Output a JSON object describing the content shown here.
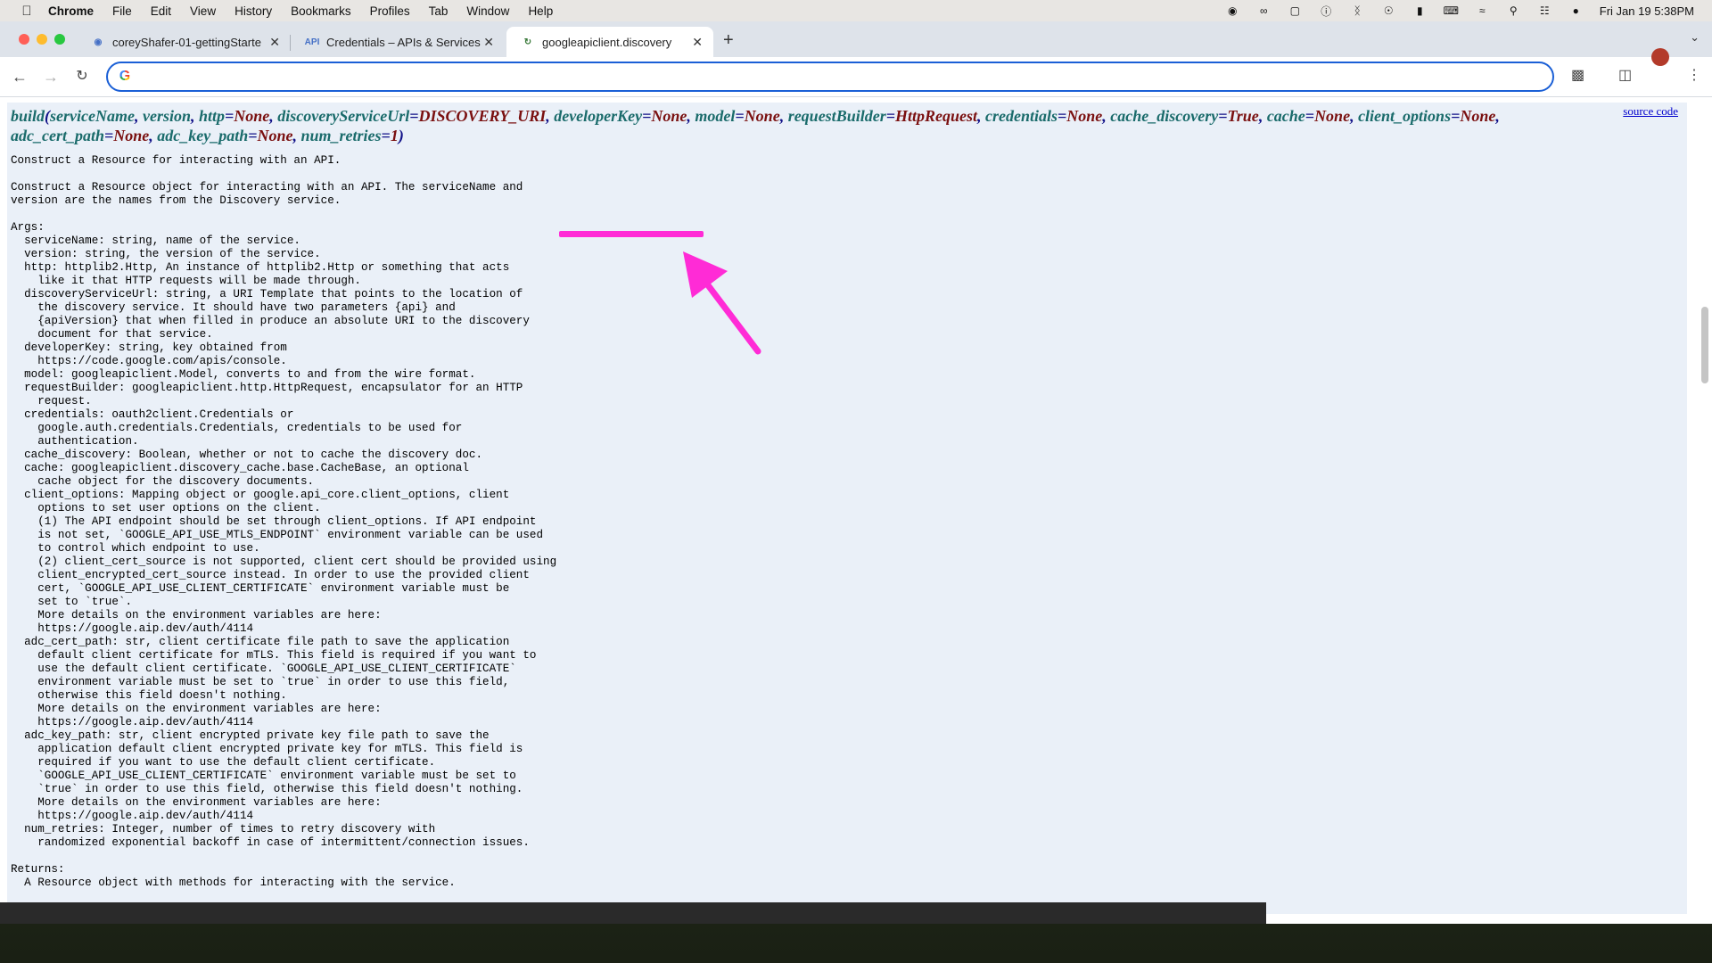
{
  "menubar": {
    "app": "Chrome",
    "items": [
      "File",
      "Edit",
      "View",
      "History",
      "Bookmarks",
      "Profiles",
      "Tab",
      "Window",
      "Help"
    ],
    "datetime": "Fri Jan 19  5:38PM"
  },
  "tabs": [
    {
      "title": "coreyShafer-01-gettingStarte",
      "favicon": "github-icon"
    },
    {
      "title": "Credentials – APIs & Services",
      "favicon": "api-icon",
      "favicon_text": "API"
    },
    {
      "title": "googleapiclient.discovery",
      "favicon": "loading-icon",
      "active": true
    }
  ],
  "omnibox": {
    "value": ""
  },
  "doc": {
    "source_link": "source code",
    "signature": {
      "name": "build",
      "params": [
        {
          "name": "serviceName"
        },
        {
          "name": "version"
        },
        {
          "name": "http",
          "default": "None"
        },
        {
          "name": "discoveryServiceUrl",
          "default": "DISCOVERY_URI"
        },
        {
          "name": "developerKey",
          "default": "None"
        },
        {
          "name": "model",
          "default": "None"
        },
        {
          "name": "requestBuilder",
          "default": "HttpRequest"
        },
        {
          "name": "credentials",
          "default": "None"
        },
        {
          "name": "cache_discovery",
          "default": "True"
        },
        {
          "name": "cache",
          "default": "None"
        },
        {
          "name": "client_options",
          "default": "None"
        },
        {
          "name": "adc_cert_path",
          "default": "None"
        },
        {
          "name": "adc_key_path",
          "default": "None"
        },
        {
          "name": "num_retries",
          "default": "1"
        }
      ]
    },
    "docstring": "Construct a Resource for interacting with an API.\n\nConstruct a Resource object for interacting with an API. The serviceName and\nversion are the names from the Discovery service.\n\nArgs:\n  serviceName: string, name of the service.\n  version: string, the version of the service.\n  http: httplib2.Http, An instance of httplib2.Http or something that acts\n    like it that HTTP requests will be made through.\n  discoveryServiceUrl: string, a URI Template that points to the location of\n    the discovery service. It should have two parameters {api} and\n    {apiVersion} that when filled in produce an absolute URI to the discovery\n    document for that service.\n  developerKey: string, key obtained from\n    https://code.google.com/apis/console.\n  model: googleapiclient.Model, converts to and from the wire format.\n  requestBuilder: googleapiclient.http.HttpRequest, encapsulator for an HTTP\n    request.\n  credentials: oauth2client.Credentials or\n    google.auth.credentials.Credentials, credentials to be used for\n    authentication.\n  cache_discovery: Boolean, whether or not to cache the discovery doc.\n  cache: googleapiclient.discovery_cache.base.CacheBase, an optional\n    cache object for the discovery documents.\n  client_options: Mapping object or google.api_core.client_options, client\n    options to set user options on the client.\n    (1) The API endpoint should be set through client_options. If API endpoint\n    is not set, `GOOGLE_API_USE_MTLS_ENDPOINT` environment variable can be used\n    to control which endpoint to use.\n    (2) client_cert_source is not supported, client cert should be provided using\n    client_encrypted_cert_source instead. In order to use the provided client\n    cert, `GOOGLE_API_USE_CLIENT_CERTIFICATE` environment variable must be\n    set to `true`.\n    More details on the environment variables are here:\n    https://google.aip.dev/auth/4114\n  adc_cert_path: str, client certificate file path to save the application\n    default client certificate for mTLS. This field is required if you want to\n    use the default client certificate. `GOOGLE_API_USE_CLIENT_CERTIFICATE`\n    environment variable must be set to `true` in order to use this field,\n    otherwise this field doesn't nothing.\n    More details on the environment variables are here:\n    https://google.aip.dev/auth/4114\n  adc_key_path: str, client encrypted private key file path to save the\n    application default client encrypted private key for mTLS. This field is\n    required if you want to use the default client certificate.\n    `GOOGLE_API_USE_CLIENT_CERTIFICATE` environment variable must be set to\n    `true` in order to use this field, otherwise this field doesn't nothing.\n    More details on the environment variables are here:\n    https://google.aip.dev/auth/4114\n  num_retries: Integer, number of times to retry discovery with\n    randomized exponential backoff in case of intermittent/connection issues.\n\nReturns:\n  A Resource object with methods for interacting with the service."
  },
  "annotation": {
    "highlight_color": "#ff2bd6",
    "highlighted_param": "developerKey"
  }
}
